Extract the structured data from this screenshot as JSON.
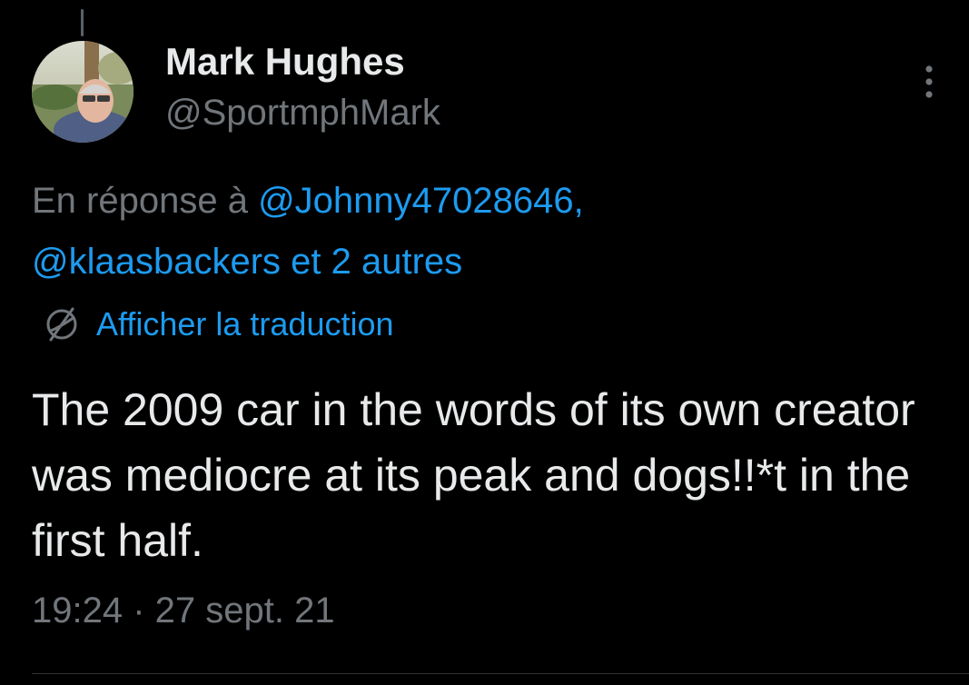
{
  "tweet": {
    "author": {
      "name": "Mark Hughes",
      "handle": "@SportmphMark",
      "avatar_icon": "profile-photo"
    },
    "reply_context": {
      "prefix": "En réponse à ",
      "mention_1": "@Johnny47028646,",
      "mention_2": "@klaasbackers",
      "suffix": " et 2 autres"
    },
    "translate": {
      "icon": "globe-slash-icon",
      "label": "Afficher la traduction"
    },
    "text": "The 2009 car in the words of its own creator was mediocre at its peak and dogs!!*t in the first half.",
    "timestamp": "19:24 · 27 sept. 21",
    "more_icon": "vertical-ellipsis-icon"
  },
  "colors": {
    "background": "#000000",
    "primary_text": "#e7e9ea",
    "secondary_text": "#71767b",
    "link": "#1d9bf0",
    "divider": "#2f3336"
  }
}
